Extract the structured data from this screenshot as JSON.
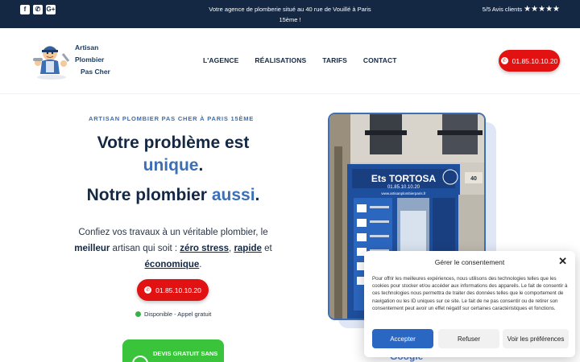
{
  "topbar": {
    "social_icons": [
      "facebook-icon",
      "whatsapp-icon",
      "google-plus-icon"
    ],
    "announcement": "Votre agence de plomberie situé au 40 rue de Vouillé à Paris 15ème !",
    "rating_text": "5/5 Avis clients",
    "stars": "★★★★★"
  },
  "header": {
    "logo": {
      "line1": "Artisan",
      "line2": "Plombier",
      "line3": "Pas Cher"
    },
    "nav": [
      "L'AGENCE",
      "RÉALISATIONS",
      "TARIFS",
      "CONTACT"
    ],
    "phone": "01.85.10.10.20"
  },
  "hero": {
    "eyebrow": "ARTISAN PLOMBIER PAS CHER À PARIS 15ÈME",
    "h1_part1": "Votre problème est",
    "h1_accent": "unique",
    "h1_end": ".",
    "h2_part1": "Notre plombier",
    "h2_accent": "aussi",
    "h2_end": ".",
    "desc_part1": "Confiez vos travaux à un véritable plombier, le",
    "desc_bold": "meilleur",
    "desc_part2": "artisan qui soit :",
    "desc_link1": "zéro stress",
    "desc_comma": ",",
    "desc_link2": "rapide",
    "desc_and": "et",
    "desc_link3": "économique",
    "desc_end": ".",
    "phone": "01.85.10.10.20",
    "availability": "Disponible - Appel gratuit",
    "devis": "DEVIS GRATUIT SANS"
  },
  "photo": {
    "shop_sign": "Ets TORTOSA",
    "shop_phone": "01.85.10.10.20",
    "shop_site": "www.artisanplombierparis.fr",
    "street_number": "40",
    "google_text": "Google"
  },
  "cookie": {
    "title": "Gérer le consentement",
    "text": "Pour offrir les meilleures expériences, nous utilisons des technologies telles que les cookies pour stocker et/ou accéder aux informations des appareils. Le fait de consentir à ces technologies nous permettra de traiter des données telles que le comportement de navigation ou les ID uniques sur ce site. Le fait de ne pas consentir ou de retirer son consentement peut avoir un effet négatif sur certaines caractéristiques et fonctions.",
    "accept": "Accepter",
    "refuse": "Refuser",
    "preferences": "Voir les préférences",
    "accent_color": "#2a67c3"
  },
  "colors": {
    "topbar": "#142844",
    "primary_blue": "#3b6fb6",
    "cta_red": "#e31212",
    "whatsapp_green": "#39c43b"
  }
}
